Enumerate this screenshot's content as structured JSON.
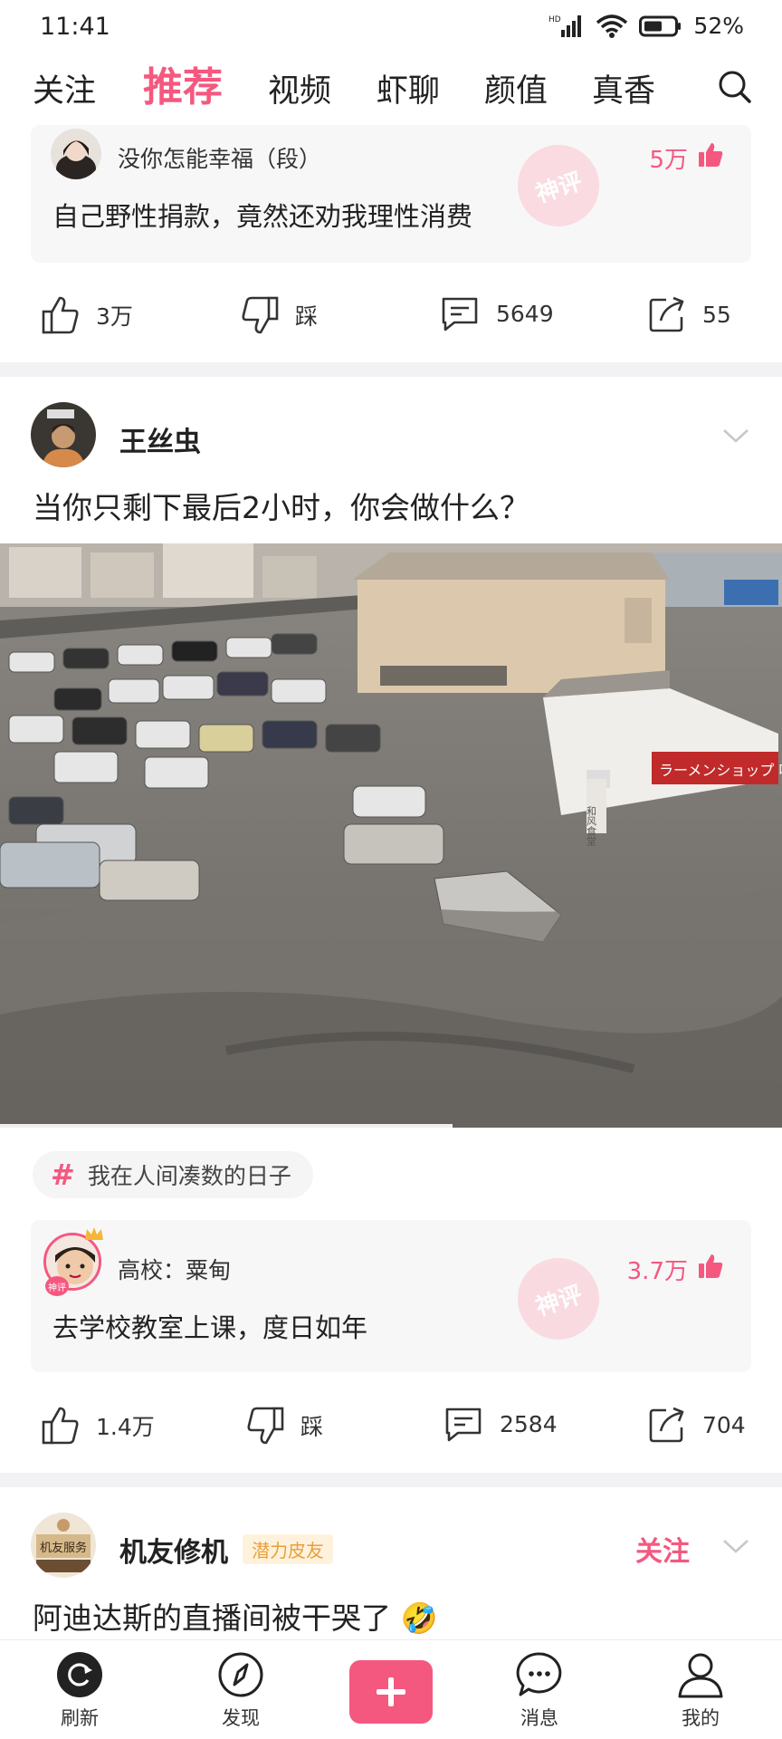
{
  "status_bar": {
    "time": "11:41",
    "battery": "52%"
  },
  "top_nav": {
    "tabs": [
      {
        "label": "关注"
      },
      {
        "label": "推荐",
        "active": true
      },
      {
        "label": "视频"
      },
      {
        "label": "虾聊"
      },
      {
        "label": "颜值"
      },
      {
        "label": "真香"
      }
    ]
  },
  "post1": {
    "hot_comment": {
      "user": "没你怎能幸福（段）",
      "likes": "5万",
      "text": "自己野性捐款，竟然还劝我理性消费",
      "stamp": "神评"
    },
    "actions": {
      "like": "3万",
      "dislike": "踩",
      "comments": "5649",
      "shares": "55"
    }
  },
  "post2": {
    "user": "王丝虫",
    "title": "当你只剩下最后2小时，你会做什么？",
    "image_overlay": {
      "sign": "ラーメンショップ 味 宮古店",
      "side_sign": "和风食堂"
    },
    "topic": "我在人间凑数的日子",
    "hot_comment": {
      "user": "高校：粟甸",
      "likes": "3.7万",
      "text": "去学校教室上课，度日如年",
      "stamp": "神评",
      "avatar_badge": "神评"
    },
    "actions": {
      "like": "1.4万",
      "dislike": "踩",
      "comments": "2584",
      "shares": "704"
    }
  },
  "post3": {
    "user": "机友修机",
    "badge": "潜力皮友",
    "follow": "关注",
    "avatar_text": "机友服务",
    "title": "阿迪达斯的直播间被干哭了 🤣"
  },
  "bottom_nav": {
    "items": [
      {
        "label": "刷新"
      },
      {
        "label": "发现"
      },
      {
        "label": ""
      },
      {
        "label": "消息"
      },
      {
        "label": "我的"
      }
    ]
  },
  "colors": {
    "accent": "#f5587f",
    "divider": "#f2f2f4",
    "comment_bg": "#f7f7f8"
  }
}
